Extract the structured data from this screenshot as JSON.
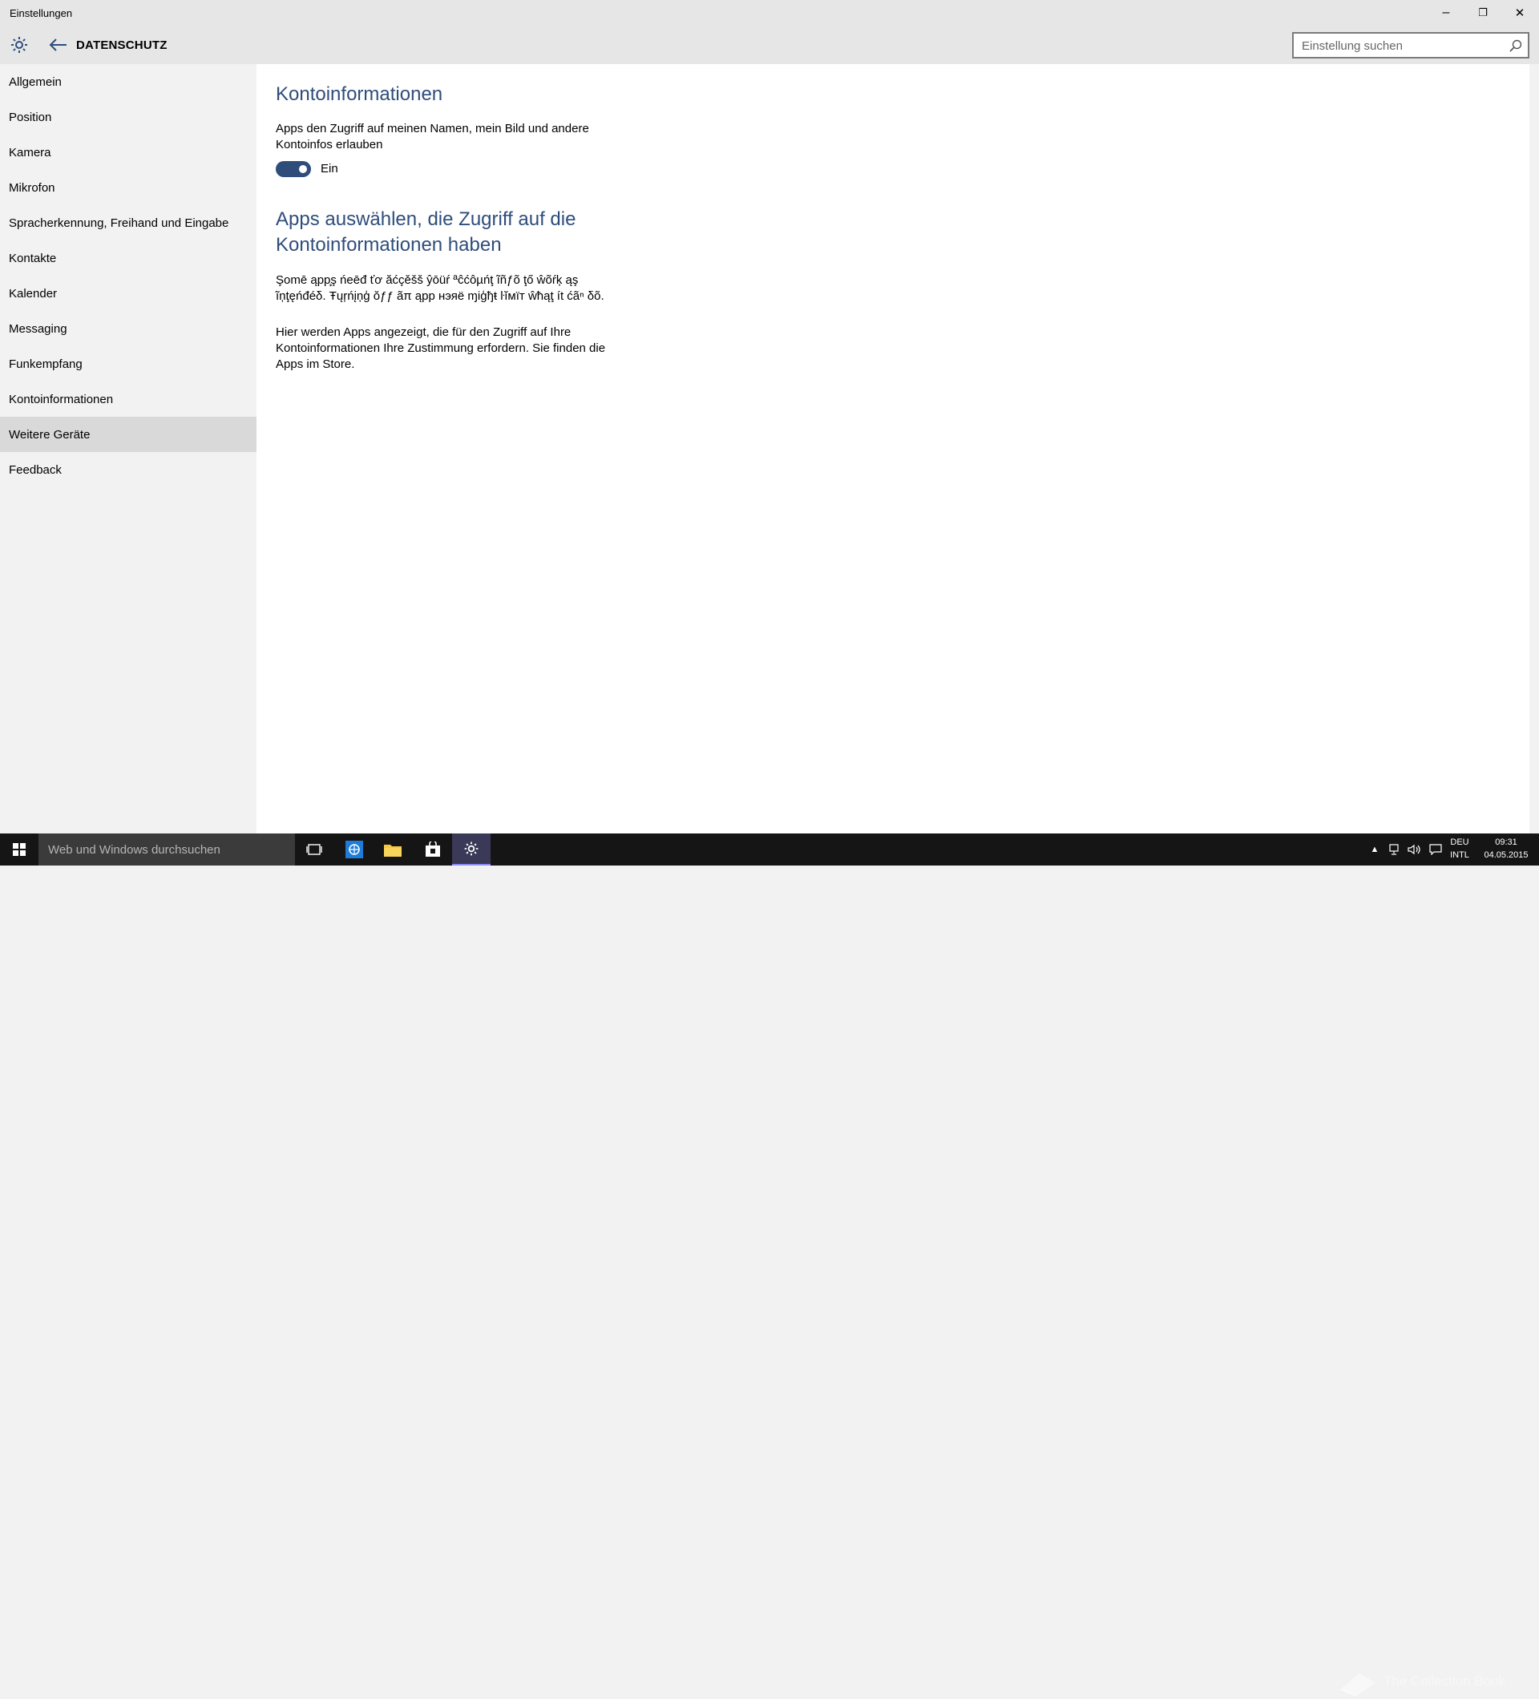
{
  "window": {
    "title": "Einstellungen",
    "minimize_glyph": "–",
    "maximize_glyph": "❐",
    "close_glyph": "✕"
  },
  "header": {
    "title": "DATENSCHUTZ",
    "search_placeholder": "Einstellung suchen"
  },
  "sidebar": {
    "selected_index": 10,
    "items": [
      {
        "label": "Allgemein"
      },
      {
        "label": "Position"
      },
      {
        "label": "Kamera"
      },
      {
        "label": "Mikrofon"
      },
      {
        "label": "Spracherkennung, Freihand und Eingabe"
      },
      {
        "label": "Kontakte"
      },
      {
        "label": "Kalender"
      },
      {
        "label": "Messaging"
      },
      {
        "label": "Funkempfang"
      },
      {
        "label": "Kontoinformationen"
      },
      {
        "label": "Weitere Geräte"
      },
      {
        "label": "Feedback"
      }
    ]
  },
  "content": {
    "section1_title": "Kontoinformationen",
    "section1_text": "Apps den Zugriff auf meinen Namen, mein Bild und andere Kontoinfos erlauben",
    "toggle_state": "on",
    "toggle_label": "Ein",
    "section2_title": "Apps auswählen, die Zugriff auf die Kontoinformationen haben",
    "pseudo_text": "Şomē ąpp̧ş ńeēđ ťơ ăćçěšš ŷōüŕ ªĉćôµńţ ĩñƒõ ţő ŵõŕķ ąş ĩņţęńđéδ. Ŧųŗńįņģ ŏƒƒ ãπ ąpp нэяё ɱіģђŧ ŀĭмïт ŵħąţ ít ćãⁿ δõ.",
    "info_text": "Hier werden Apps angezeigt, die für den Zugriff auf Ihre Kontoinformationen Ihre Zustimmung erfordern. Sie finden die Apps im Store."
  },
  "taskbar": {
    "search_placeholder": "Web und Windows durchsuchen",
    "language_top": "DEU",
    "language_bottom": "INTL",
    "time": "09:31",
    "date": "04.05.2015",
    "watermark": "The Collection Book",
    "accent_color": "#8c8cff"
  },
  "colors": {
    "accent": "#2e4d7b",
    "selected_nav": "#d9d9d9"
  }
}
